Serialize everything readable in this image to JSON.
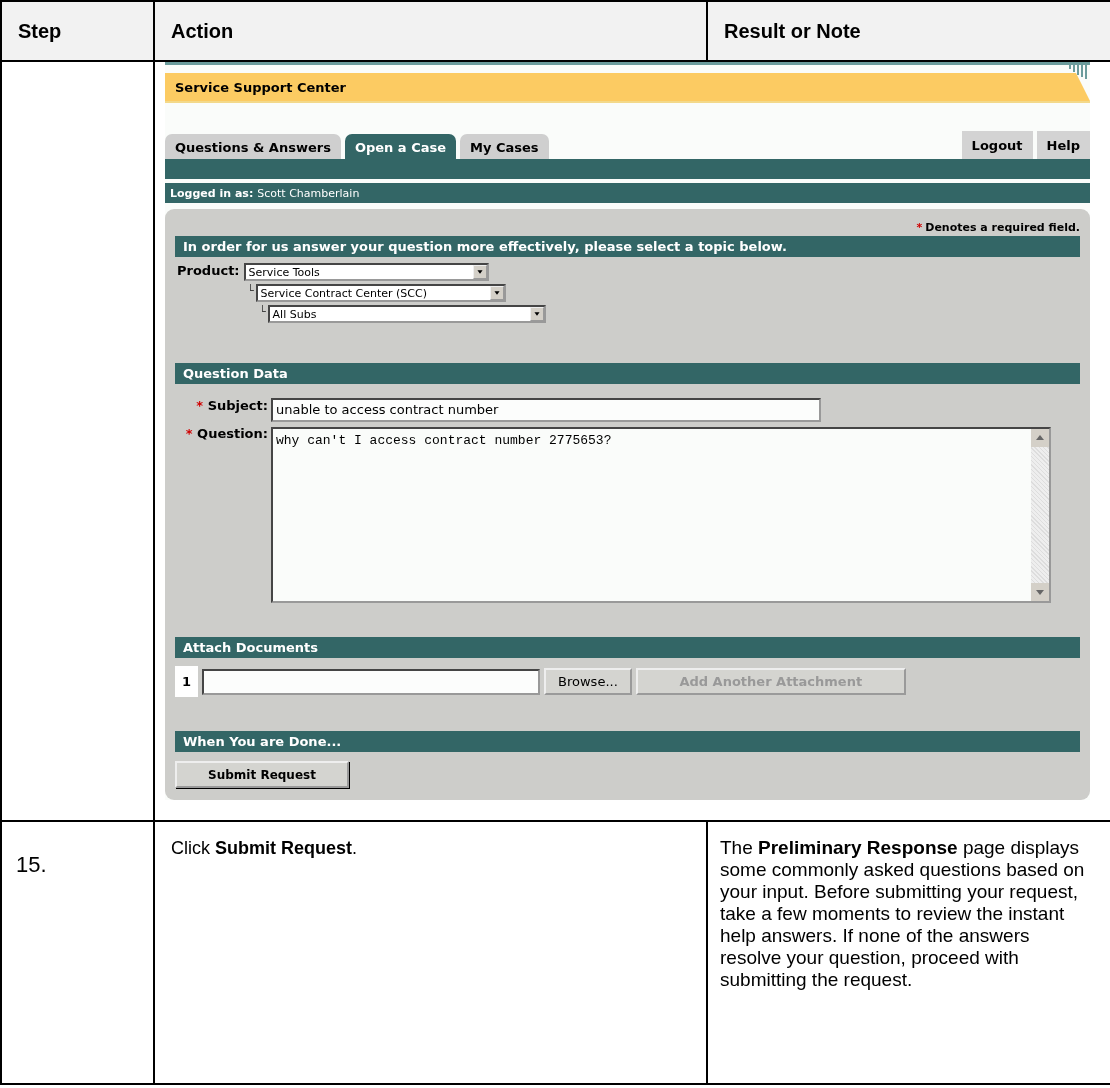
{
  "table": {
    "columns": [
      "Step",
      "Action",
      "Result or Note"
    ],
    "screenshot": {
      "app_title": "Service Support Center",
      "tabs": [
        {
          "label": "Questions & Answers",
          "selected": false
        },
        {
          "label": "Open a Case",
          "selected": true
        },
        {
          "label": "My Cases",
          "selected": false
        }
      ],
      "header_buttons": [
        "Logout",
        "Help"
      ],
      "login": {
        "label": "Logged in as:",
        "user": "Scott Chamberlain"
      },
      "required_note": {
        "mark": "*",
        "text": "Denotes a required field."
      },
      "topic_section": {
        "title": "In order for us answer your question more effectively, please select a topic below.",
        "product_label": "Product:",
        "selects": [
          {
            "value": "Service Tools"
          },
          {
            "value": "Service Contract Center (SCC)",
            "connector": "└"
          },
          {
            "value": "All Subs",
            "connector": "└"
          }
        ]
      },
      "question_section": {
        "title": "Question Data",
        "subject": {
          "mark": "*",
          "label": "Subject:",
          "value": "unable to access contract number"
        },
        "question": {
          "mark": "*",
          "label": "Question:",
          "value": "why can't I access contract number 2775653?"
        }
      },
      "attach_section": {
        "title": "Attach Documents",
        "number": "1",
        "buttons": [
          {
            "label": "Browse...",
            "disabled": false
          },
          {
            "label": "Add Another Attachment",
            "disabled": true
          }
        ]
      },
      "done_section": {
        "title": "When You are Done...",
        "button": "Submit Request"
      }
    },
    "rows": [
      {
        "step": "15.",
        "action": "Click **Submit Request**.",
        "result": "The **Preliminary Response** page displays some commonly asked questions based on your input. Before submitting your request, take a few moments to review the instant help answers. If none of the answers resolve your question, proceed with submitting the request."
      }
    ]
  }
}
